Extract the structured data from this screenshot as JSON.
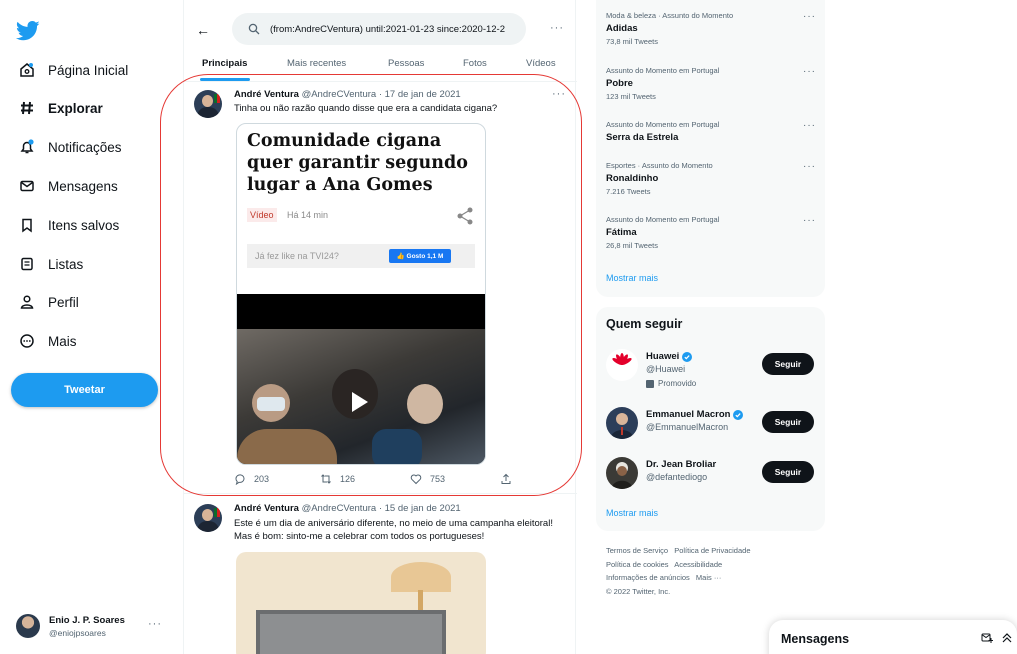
{
  "sidebar": {
    "nav": [
      {
        "label": "Página Inicial"
      },
      {
        "label": "Explorar"
      },
      {
        "label": "Notificações"
      },
      {
        "label": "Mensagens"
      },
      {
        "label": "Itens salvos"
      },
      {
        "label": "Listas"
      },
      {
        "label": "Perfil"
      },
      {
        "label": "Mais"
      }
    ],
    "tweet_button": "Tweetar",
    "account": {
      "name": "Enio J. P. Soares",
      "handle": "@eniojpsoares",
      "more": "···"
    }
  },
  "search": {
    "value": "(from:AndreCVentura) until:2021-01-23 since:2020-12-2"
  },
  "top_more": "···",
  "tabs": [
    "Principais",
    "Mais recentes",
    "Pessoas",
    "Fotos",
    "Vídeos"
  ],
  "tweets": [
    {
      "name": "André Ventura",
      "meta": "@AndreCVentura · 17 de jan de 2021",
      "text": "Tinha ou não razão quando disse que era a candidata cigana?",
      "card": {
        "title": "Comunidade cigana quer garantir segundo lugar a Ana Gomes",
        "tag": "Vídeo",
        "time": "Há 14 min",
        "like_text": "Já fez like na TVI24?",
        "like_button": "👍 Gosto 1,1 M"
      },
      "replies": "203",
      "retweets": "126",
      "likes": "753"
    },
    {
      "name": "André Ventura",
      "meta": "@AndreCVentura · 15 de jan de 2021",
      "text_lines": [
        "Este é um dia de aniversário diferente, no meio de uma campanha eleitoral!",
        "Mas é bom: sinto-me a celebrar com todos os portugueses!"
      ]
    }
  ],
  "trends": [
    {
      "context": "Moda & beleza · Assunto do Momento",
      "name": "Adidas",
      "count": "73,8 mil Tweets"
    },
    {
      "context": "Assunto do Momento em Portugal",
      "name": "Pobre",
      "count": "123 mil Tweets"
    },
    {
      "context": "Assunto do Momento em Portugal",
      "name": "Serra da Estrela",
      "count": ""
    },
    {
      "context": "Esportes · Assunto do Momento",
      "name": "Ronaldinho",
      "count": "7.216 Tweets"
    },
    {
      "context": "Assunto do Momento em Portugal",
      "name": "Fátima",
      "count": "26,8 mil Tweets"
    }
  ],
  "trends_show_more": "Mostrar mais",
  "who_to_follow": {
    "title": "Quem seguir",
    "accounts": [
      {
        "name": "Huawei",
        "handle": "@Huawei",
        "promoted": "Promovido",
        "button": "Seguir"
      },
      {
        "name": "Emmanuel Macron",
        "handle": "@EmmanuelMacron",
        "button": "Seguir"
      },
      {
        "name": "Dr. Jean Broliar",
        "handle": "@defantediogo",
        "button": "Seguir"
      }
    ],
    "show_more": "Mostrar mais"
  },
  "footer": {
    "links": [
      "Termos de Serviço",
      "Política de Privacidade",
      "Política de cookies",
      "Acessibilidade",
      "Informações de anúncios",
      "Mais ···"
    ],
    "copyright": "© 2022 Twitter, Inc."
  },
  "messages": {
    "title": "Mensagens"
  },
  "colors": {
    "brand": "#1d9bf0",
    "text": "#0f1419",
    "muted": "#536471",
    "annotation": "#e53935"
  }
}
